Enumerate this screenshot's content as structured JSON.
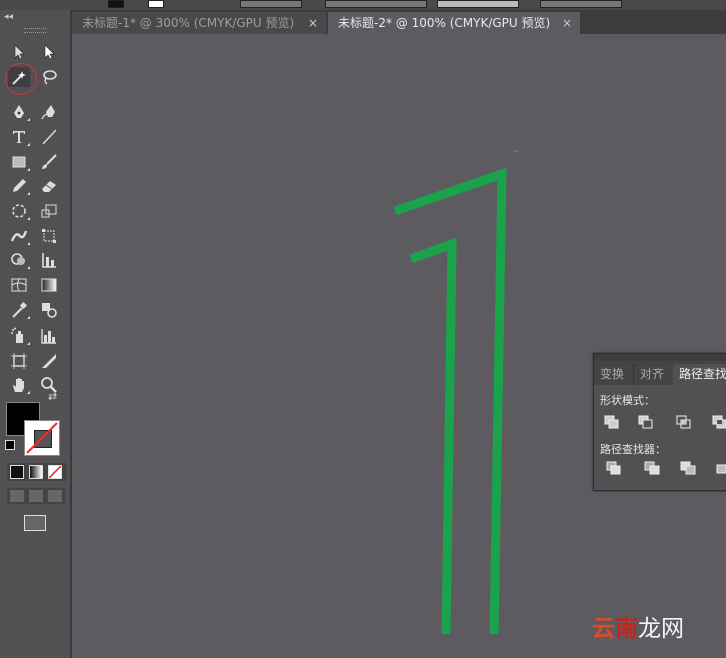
{
  "tabs": [
    {
      "label": "未标题-1* @ 300% (CMYK/GPU 预览)",
      "close": "×"
    },
    {
      "label": "未标题-2* @ 100% (CMYK/GPU 预览)",
      "close": "×"
    }
  ],
  "toolbar": {
    "collapse_label": "◂◂",
    "tools": [
      "selection-tool",
      "direct-selection-tool",
      "magic-wand-tool",
      "lasso-tool",
      "pen-tool",
      "curvature-tool",
      "type-tool",
      "line-segment-tool",
      "rectangle-tool",
      "paintbrush-tool",
      "pencil-tool",
      "eraser-tool",
      "rotate-tool",
      "scale-tool",
      "width-tool",
      "free-transform-tool",
      "shape-builder-tool",
      "perspective-grid-tool",
      "mesh-tool",
      "gradient-tool",
      "eyedropper-tool",
      "blend-tool",
      "symbol-sprayer-tool",
      "column-graph-tool",
      "artboard-tool",
      "slice-tool",
      "hand-tool",
      "zoom-tool"
    ],
    "fill_color": "#000000",
    "stroke_color": "#ffffff",
    "swap_icon": "⇄"
  },
  "pathfinder_panel": {
    "tabs": [
      "变换",
      "对齐",
      "路径查找"
    ],
    "shape_modes_label": "形状模式：",
    "pathfinders_label": "路径查找器："
  },
  "artwork": {
    "stroke_color": "#1ba34c"
  },
  "watermark": {
    "part1": "云",
    "part2": "南",
    "part3": "龙网"
  }
}
